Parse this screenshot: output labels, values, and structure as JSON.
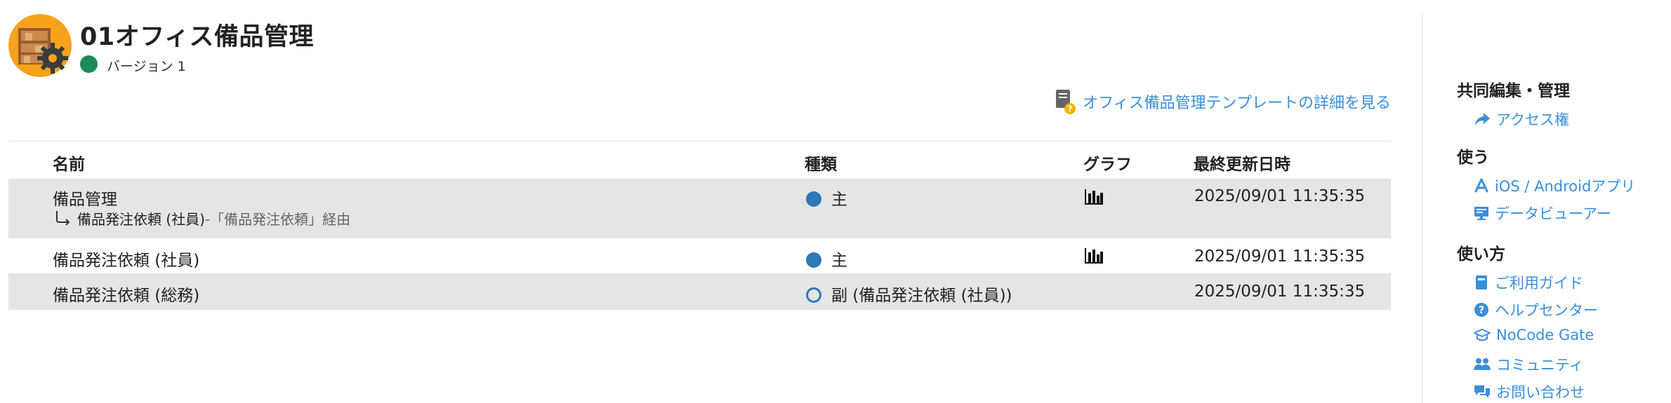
{
  "app": {
    "title": "01オフィス備品管理",
    "version": "バージョン 1",
    "status_color": "#1e8a5a",
    "icon": "shelf-gear-icon"
  },
  "template_link": {
    "label": "オフィス備品管理テンプレートの詳細を見る",
    "icon": "template-doc-help-icon"
  },
  "table": {
    "headers": {
      "name": "名前",
      "kind": "種類",
      "graph": "グラフ",
      "updated": "最終更新日時"
    },
    "rows": [
      {
        "name": "備品管理",
        "sub_name": "備品発注依頼 (社員)",
        "sub_via": " -「備品発注依頼」経由",
        "kind": "主",
        "kind_icon": "filled-circle",
        "graph": true,
        "updated": "2025/09/01 11:35:35"
      },
      {
        "name": "備品発注依頼 (社員)",
        "kind": "主",
        "kind_icon": "filled-circle",
        "graph": true,
        "updated": "2025/09/01 11:35:35"
      },
      {
        "name": "備品発注依頼 (総務)",
        "kind": "副 (備品発注依頼 (社員))",
        "kind_icon": "hollow-circle",
        "graph": false,
        "updated": "2025/09/01 11:35:35"
      }
    ]
  },
  "sidebar": {
    "sections": [
      {
        "heading": "共同編集・管理",
        "links": [
          {
            "label": "アクセス権",
            "icon": "share-arrow-icon"
          }
        ]
      },
      {
        "heading": "使う",
        "links": [
          {
            "label": "iOS / Androidアプリ",
            "icon": "app-store-icon"
          },
          {
            "label": "データビューアー",
            "icon": "monitor-icon"
          }
        ]
      },
      {
        "heading": "使い方",
        "links": [
          {
            "label": "ご利用ガイド",
            "icon": "book-icon"
          },
          {
            "label": "ヘルプセンター",
            "icon": "question-circle-icon"
          },
          {
            "label": "NoCode Gate",
            "icon": "graduation-cap-icon"
          },
          {
            "label": "コミュニティ",
            "icon": "users-icon"
          },
          {
            "label": "お問い合わせ",
            "icon": "chat-bubbles-icon"
          }
        ]
      }
    ]
  },
  "colors": {
    "accent": "#3a8fd9",
    "kind_dot": "#2f77b5",
    "row_stripe": "#e5e5e5",
    "app_icon_orange": "#f7a21b"
  }
}
